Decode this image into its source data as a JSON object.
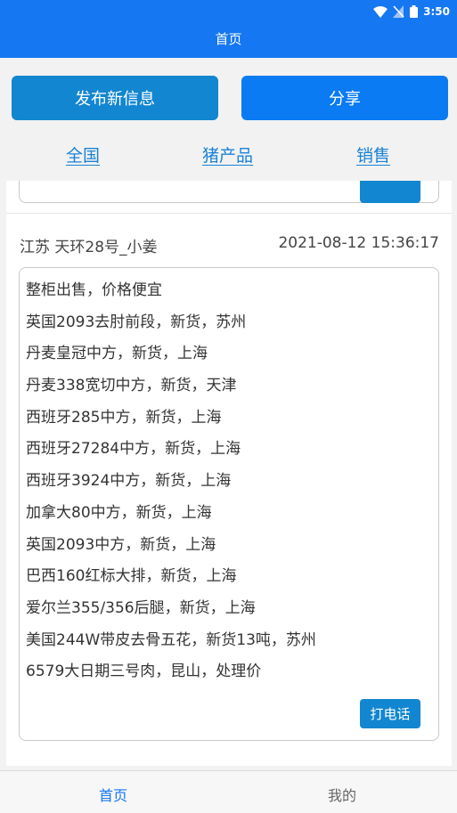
{
  "status_bar": {
    "time": "3:50"
  },
  "header": {
    "title": "首页"
  },
  "actions": {
    "publish_label": "发布新信息",
    "share_label": "分享"
  },
  "filters": [
    "全国",
    "猪产品",
    "销售"
  ],
  "post": {
    "author": "江苏 天环28号_小姜",
    "time": "2021-08-12 15:36:17",
    "lines": [
      "整柜出售，价格便宜",
      "英国2093去肘前段，新货，苏州",
      "丹麦皇冠中方，新货，上海",
      "丹麦338宽切中方，新货，天津",
      "西班牙285中方，新货，上海",
      "西班牙27284中方，新货，上海",
      "西班牙3924中方，新货，上海",
      "加拿大80中方，新货，上海",
      "英国2093中方，新货，上海",
      "巴西160红标大排，新货，上海",
      "爱尔兰355/356后腿，新货，上海",
      "美国244W带皮去骨五花，新货13吨，苏州",
      "6579大日期三号肉，昆山，处理价"
    ],
    "call_label": "打电话"
  },
  "bottom_nav": {
    "home_label": "首页",
    "mine_label": "我的"
  },
  "colors": {
    "primary": "#1677f2",
    "button": "#1286d0",
    "link": "#1a82d6"
  }
}
